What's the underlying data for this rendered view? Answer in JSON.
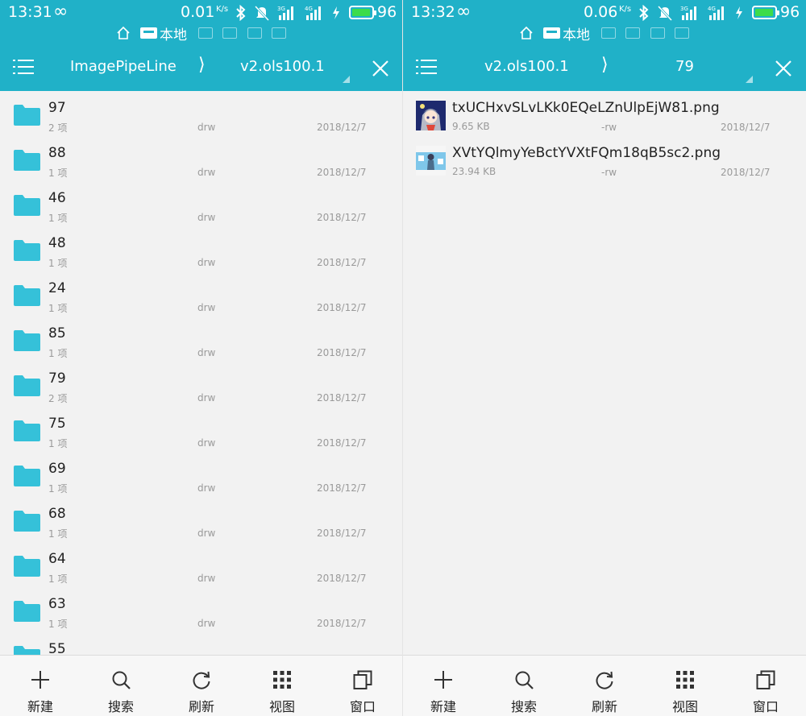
{
  "colors": {
    "accent": "#20b1c8",
    "folder": "#35c1d9",
    "battery": "#3cdc4a"
  },
  "left": {
    "status": {
      "time": "13:31",
      "speed": "0.01",
      "unit": "K/s",
      "battery": "96",
      "battery_level": 0.96
    },
    "location": {
      "local_label": "本地"
    },
    "toolbar": {
      "crumb1": "ImagePipeLine",
      "separator": "⟩",
      "crumb2": "v2.ols100.1"
    },
    "items": [
      {
        "name": "97",
        "sub": "2 项",
        "perm": "drw",
        "date": "2018/12/7"
      },
      {
        "name": "88",
        "sub": "1 项",
        "perm": "drw",
        "date": "2018/12/7"
      },
      {
        "name": "46",
        "sub": "1 项",
        "perm": "drw",
        "date": "2018/12/7"
      },
      {
        "name": "48",
        "sub": "1 项",
        "perm": "drw",
        "date": "2018/12/7"
      },
      {
        "name": "24",
        "sub": "1 项",
        "perm": "drw",
        "date": "2018/12/7"
      },
      {
        "name": "85",
        "sub": "1 项",
        "perm": "drw",
        "date": "2018/12/7"
      },
      {
        "name": "79",
        "sub": "2 项",
        "perm": "drw",
        "date": "2018/12/7"
      },
      {
        "name": "75",
        "sub": "1 项",
        "perm": "drw",
        "date": "2018/12/7"
      },
      {
        "name": "69",
        "sub": "1 项",
        "perm": "drw",
        "date": "2018/12/7"
      },
      {
        "name": "68",
        "sub": "1 项",
        "perm": "drw",
        "date": "2018/12/7"
      },
      {
        "name": "64",
        "sub": "1 项",
        "perm": "drw",
        "date": "2018/12/7"
      },
      {
        "name": "63",
        "sub": "1 项",
        "perm": "drw",
        "date": "2018/12/7"
      },
      {
        "name": "55",
        "sub": "",
        "perm": "",
        "date": ""
      }
    ]
  },
  "right": {
    "status": {
      "time": "13:32",
      "speed": "0.06",
      "unit": "K/s",
      "battery": "96",
      "battery_level": 0.96
    },
    "location": {
      "local_label": "本地"
    },
    "toolbar": {
      "crumb1": "v2.ols100.1",
      "separator": "⟩",
      "crumb2": "79"
    },
    "files": [
      {
        "name": "txUCHxvSLvLKk0EQeLZnUlpEjW81.png",
        "size": "9.65 KB",
        "perm": "-rw",
        "date": "2018/12/7",
        "thumb_icon": "anime-character-thumbnail"
      },
      {
        "name": "XVtYQlmyYeBctYVXtFQm18qB5sc2.png",
        "size": "23.94 KB",
        "perm": "-rw",
        "date": "2018/12/7",
        "thumb_icon": "character-figure-thumbnail"
      }
    ]
  },
  "bottom_bar": [
    {
      "label": "新建",
      "icon": "plus-icon"
    },
    {
      "label": "搜索",
      "icon": "search-icon"
    },
    {
      "label": "刷新",
      "icon": "refresh-icon"
    },
    {
      "label": "视图",
      "icon": "grid-icon"
    },
    {
      "label": "窗口",
      "icon": "window-icon"
    }
  ]
}
